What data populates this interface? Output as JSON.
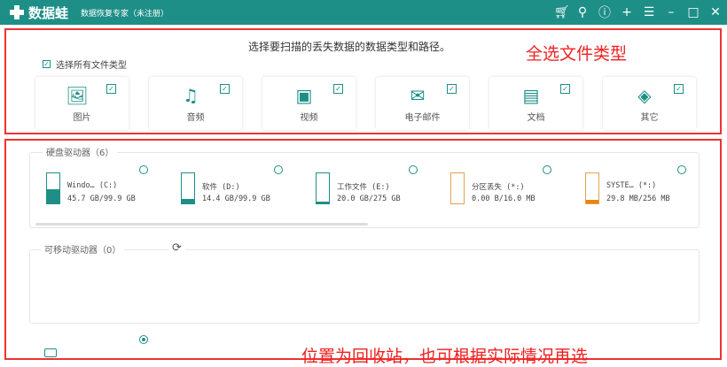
{
  "titlebar": {
    "app_name": "数据蛙",
    "subtitle": "数据恢复专家（未注册）"
  },
  "prompt": "选择要扫描的丢失数据的数据类型和路径。",
  "annotation_top": "全选文件类型",
  "select_all": {
    "label": "选择所有文件类型",
    "checked": true
  },
  "file_types": [
    {
      "label": "图片",
      "icon": "image-icon",
      "checked": true
    },
    {
      "label": "音频",
      "icon": "audio-icon",
      "checked": true
    },
    {
      "label": "视频",
      "icon": "video-icon",
      "checked": true
    },
    {
      "label": "电子邮件",
      "icon": "email-icon",
      "checked": true
    },
    {
      "label": "文档",
      "icon": "document-icon",
      "checked": true
    },
    {
      "label": "其它",
      "icon": "other-icon",
      "checked": true
    }
  ],
  "hard_drives": {
    "title": "硬盘驱动器（6）",
    "items": [
      {
        "name": "Windo… (C:)",
        "size": "45.7 GB/99.9 GB",
        "used": 0.46,
        "color": "#1d8f87"
      },
      {
        "name": "软件 (D:)",
        "size": "14.4 GB/99.9 GB",
        "used": 0.14,
        "color": "#1d8f87"
      },
      {
        "name": "工作文件 (E:)",
        "size": "20.0 GB/275 GB",
        "used": 0.07,
        "color": "#1d8f87"
      },
      {
        "name": "分区丢失 (*:)",
        "size": "0.00  B/16.0 MB",
        "used": 0,
        "color": "#e8850f"
      },
      {
        "name": "SYSTE… (*:)",
        "size": "29.8 MB/256 MB",
        "used": 0.12,
        "color": "#e8850f"
      }
    ]
  },
  "removable": {
    "title": "可移动驱动器（0）"
  },
  "annotation_bottom": "位置为回收站，也可根据实际情况再选"
}
